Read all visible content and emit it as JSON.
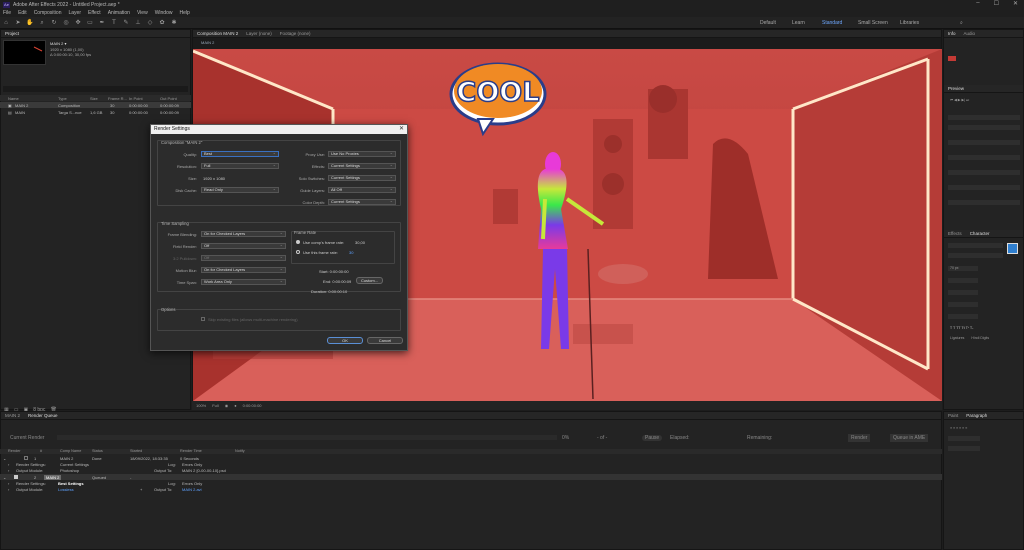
{
  "window": {
    "title": "Adobe After Effects 2022 - Untitled Project.aep *",
    "logo": "Ae"
  },
  "menu": [
    "File",
    "Edit",
    "Composition",
    "Layer",
    "Effect",
    "Animation",
    "View",
    "Window",
    "Help"
  ],
  "workspaces": [
    "Default",
    "Learn",
    "Standard",
    "Small Screen",
    "Libraries"
  ],
  "workspace_active": "Standard",
  "project": {
    "tab": "Project",
    "comp_name": "MAIN 2 ▾",
    "comp_size": "1920 x 1080 (1,00)",
    "comp_duration": "Δ 0:00:00:10, 30,00 fps",
    "columns": [
      "Name",
      "Type",
      "Size",
      "Frame R...",
      "In Point",
      "Out Point"
    ],
    "rows": [
      {
        "name": "MAIN 2",
        "type": "Composition",
        "size": "",
        "fr": "30",
        "in": "0:00:00:00",
        "out": "0:00:00:09"
      },
      {
        "name": "MAIN",
        "type": "Targa S...nce",
        "size": "1,6 GB",
        "fr": "30",
        "in": "0:00:00:00",
        "out": "0:00:00:09"
      }
    ],
    "footer_label": "8 bpc"
  },
  "composition": {
    "tab": "Composition MAIN 2",
    "subtab": "MAIN 2",
    "sticker": "COOL",
    "footer": [
      "100%",
      "Full",
      "0:00:00:00"
    ]
  },
  "dialog": {
    "title": "Render Settings",
    "comp_label": "Composition \"MAIN 2\"",
    "quality_label": "Quality:",
    "quality": "Best",
    "resolution_label": "Resolution:",
    "resolution": "Full",
    "size_label": "Size:",
    "size": "1920 x 1080",
    "disk_cache_label": "Disk Cache:",
    "disk_cache": "Read Only",
    "proxy_label": "Proxy Use:",
    "proxy": "Use No Proxies",
    "effects_label": "Effects:",
    "effects": "Current Settings",
    "solo_label": "Solo Switches:",
    "solo": "Current Settings",
    "guide_label": "Guide Layers:",
    "guide": "All Off",
    "color_label": "Color Depth:",
    "color": "Current Settings",
    "time_sampling": "Time Sampling",
    "frame_blending_label": "Frame Blending:",
    "frame_blending": "On for Checked Layers",
    "field_render_label": "Field Render:",
    "field_render": "Off",
    "pulldown_label": "3:2 Pulldown:",
    "pulldown": "Off",
    "motion_blur_label": "Motion Blur:",
    "motion_blur": "On for Checked Layers",
    "time_span_label": "Time Span:",
    "time_span": "Work Area Only",
    "frame_rate": "Frame Rate",
    "use_comp_fr": "Use comp's frame rate:",
    "comp_fr_value": "30,00",
    "use_this_fr": "Use this frame rate:",
    "this_fr_value": "30",
    "start": "Start: 0:00:00:00",
    "end": "End: 0:00:00:09",
    "duration": "Duration: 0:00:00:10",
    "custom_btn": "Custom...",
    "options": "Options",
    "skip_existing": "Skip existing files (allows multi-machine rendering)",
    "ok": "OK",
    "cancel": "Cancel"
  },
  "render_queue": {
    "tabs": [
      "MAIN 2",
      "Render Queue"
    ],
    "current_render": "Current Render",
    "percent": "0%",
    "of": "- of -",
    "elapsed_label": "Elapsed:",
    "remaining_label": "Remaining:",
    "render_btn": "Render",
    "queue_ame_btn": "Queue in AME",
    "columns": [
      "Render",
      "#",
      "Comp Name",
      "Status",
      "Started",
      "Render Time",
      "Notify"
    ],
    "items": [
      {
        "num": "1",
        "comp": "MAIN 2",
        "status": "Done",
        "started": "18/09/2022, 18:33:35",
        "time": "0 Seconds"
      },
      {
        "num": "2",
        "comp": "MAIN 2",
        "status": "Queued",
        "started": "-",
        "time": "",
        "sel": true
      }
    ],
    "sub": [
      {
        "label": "Render Settings:",
        "value": "Current Settings",
        "log_label": "Log:",
        "log": "Errors Only"
      },
      {
        "label": "Output Module:",
        "value": "Photoshop",
        "out_label": "Output To:",
        "out": "MAIN 2 [0-00-00-10].psd"
      },
      {
        "label": "Render Settings:",
        "value": "Best Settings",
        "log_label": "Log:",
        "log": "Errors Only"
      },
      {
        "label": "Output Module:",
        "value": "Lossless",
        "out_label": "Output To:",
        "out": "MAIN 2.avi"
      }
    ]
  },
  "right": {
    "tab1": "Info",
    "tab2": "Audio",
    "tab3": "Preview",
    "tab4": "Effects & Presets",
    "char_tab": "Character",
    "para_tabs": [
      "Paint",
      "Paragraph"
    ],
    "font_size": "70 px",
    "footer": [
      "Ligatures",
      "Hindi Digits"
    ]
  }
}
